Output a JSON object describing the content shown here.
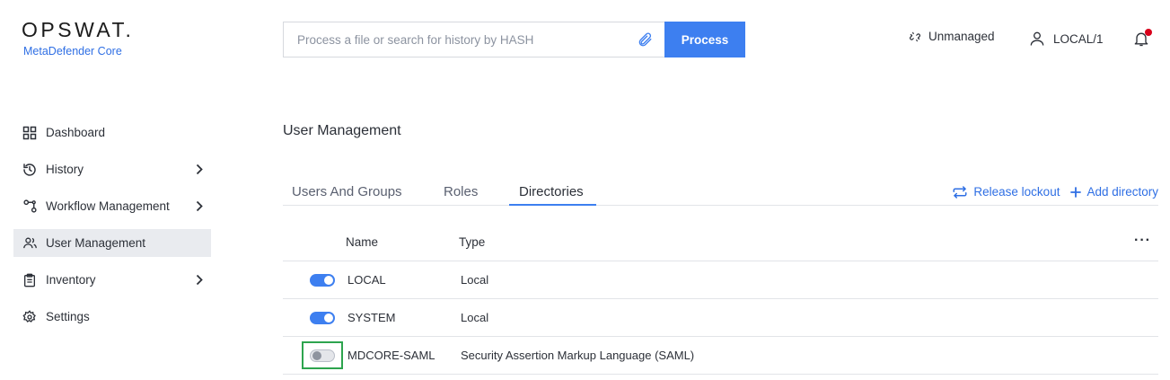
{
  "brand": {
    "logo_text": "OPSWAT.",
    "product": "MetaDefender Core"
  },
  "search": {
    "placeholder": "Process a file or search for history by HASH",
    "value": ""
  },
  "header": {
    "process_label": "Process",
    "unmanaged_label": "Unmanaged",
    "user_label": "LOCAL/1",
    "notification_dot_color": "#d8001b"
  },
  "sidebar": {
    "items": [
      {
        "label": "Dashboard",
        "icon": "dashboard-grid-icon",
        "has_chevron": false,
        "active": false
      },
      {
        "label": "History",
        "icon": "history-icon",
        "has_chevron": true,
        "active": false
      },
      {
        "label": "Workflow Management",
        "icon": "workflow-icon",
        "has_chevron": true,
        "active": false
      },
      {
        "label": "User Management",
        "icon": "users-icon",
        "has_chevron": false,
        "active": true
      },
      {
        "label": "Inventory",
        "icon": "clipboard-icon",
        "has_chevron": true,
        "active": false
      },
      {
        "label": "Settings",
        "icon": "gear-icon",
        "has_chevron": false,
        "active": false
      }
    ]
  },
  "main": {
    "title": "User Management",
    "tabs": [
      {
        "label": "Users And Groups",
        "active": false
      },
      {
        "label": "Roles",
        "active": false
      },
      {
        "label": "Directories",
        "active": true
      }
    ],
    "actions": {
      "release_lockout": "Release lockout",
      "add_directory": "Add directory"
    },
    "table": {
      "columns": {
        "name": "Name",
        "type": "Type"
      },
      "rows": [
        {
          "name": "LOCAL",
          "type": "Local",
          "enabled": true
        },
        {
          "name": "SYSTEM",
          "type": "Local",
          "enabled": true
        },
        {
          "name": "MDCORE-SAML",
          "type": "Security Assertion Markup Language (SAML)",
          "enabled": false
        }
      ]
    }
  },
  "colors": {
    "accent": "#3d7ff0",
    "highlight_box": "#2da44e"
  }
}
